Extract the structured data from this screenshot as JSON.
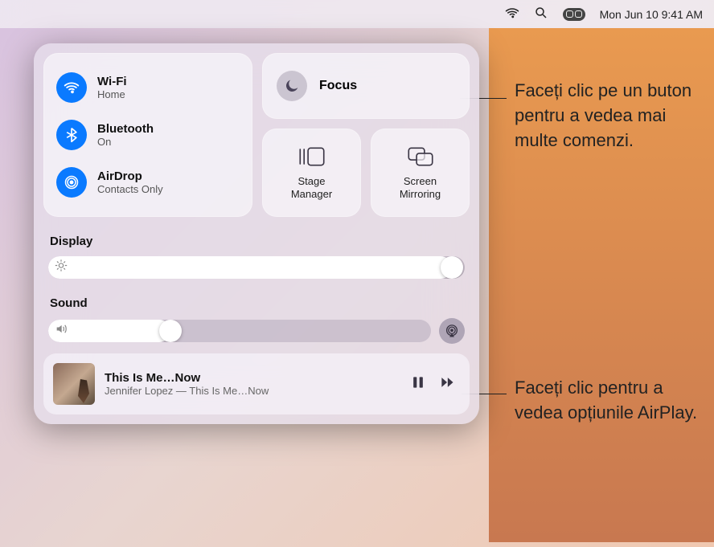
{
  "menubar": {
    "date_time": "Mon Jun 10  9:41 AM"
  },
  "connectivity": {
    "wifi": {
      "title": "Wi-Fi",
      "status": "Home"
    },
    "bluetooth": {
      "title": "Bluetooth",
      "status": "On"
    },
    "airdrop": {
      "title": "AirDrop",
      "status": "Contacts Only"
    }
  },
  "focus": {
    "label": "Focus"
  },
  "utils": {
    "stage_manager": "Stage\nManager",
    "screen_mirroring": "Screen\nMirroring"
  },
  "sliders": {
    "display_label": "Display",
    "display_value_pct": 97,
    "sound_label": "Sound",
    "sound_value_pct": 32
  },
  "now_playing": {
    "title": "This Is Me…Now",
    "subtitle": "Jennifer Lopez — This Is Me…Now"
  },
  "callouts": {
    "focus": "Faceți clic pe un buton pentru a vedea mai multe comenzi.",
    "airplay": "Faceți clic pentru a vedea opțiunile AirPlay."
  }
}
